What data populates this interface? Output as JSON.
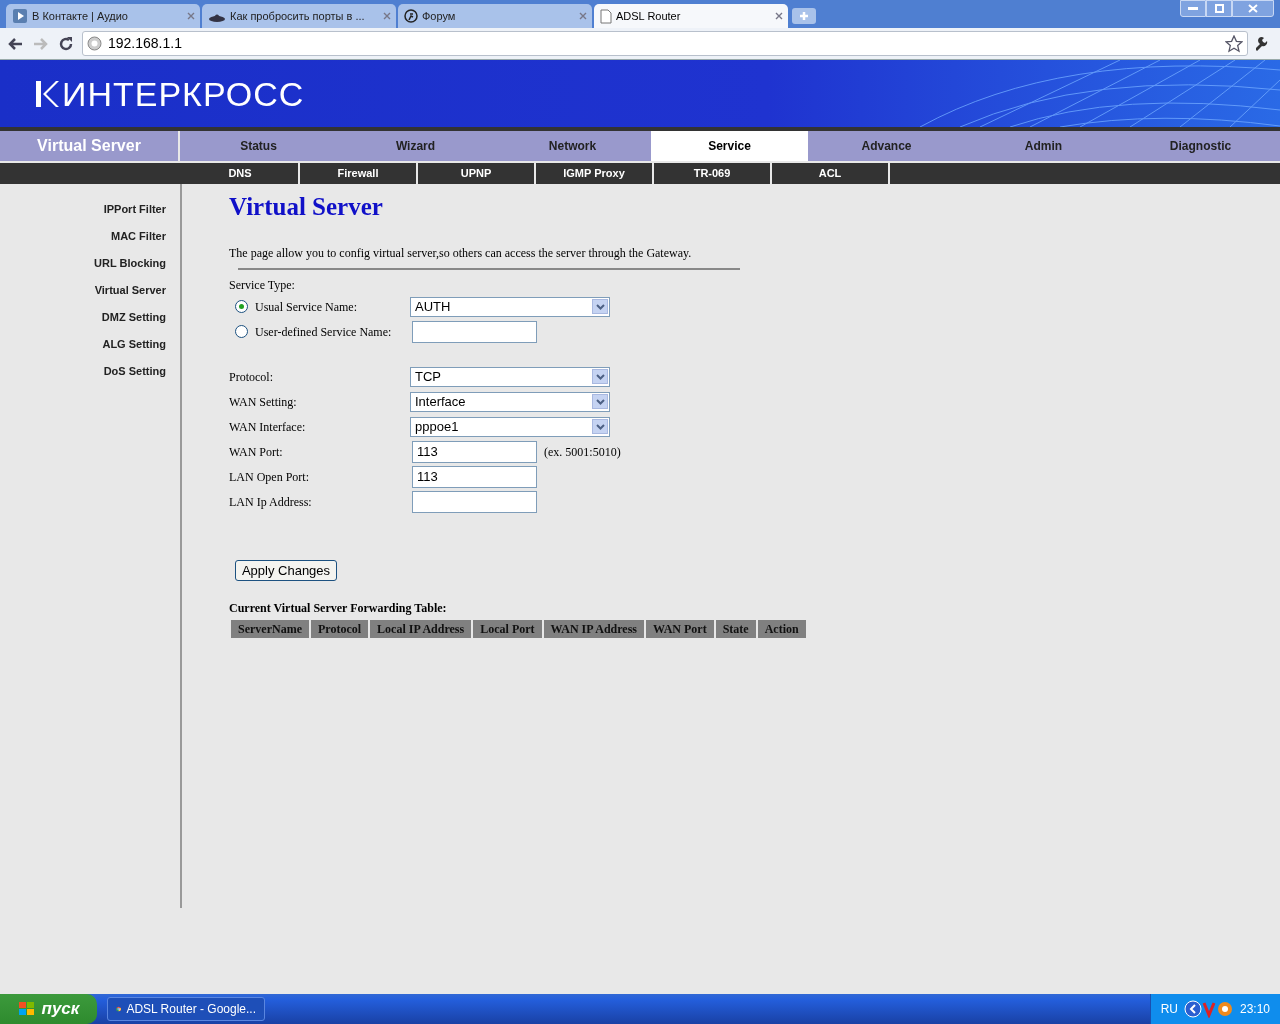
{
  "browser": {
    "tabs": [
      {
        "title": "В Контакте | Аудио",
        "selected": false,
        "kind": "play"
      },
      {
        "title": "Как пробросить порты в ...",
        "selected": false,
        "kind": "hat"
      },
      {
        "title": "Форум",
        "selected": false,
        "kind": "runner"
      },
      {
        "title": "ADSL Router",
        "selected": true,
        "kind": "page"
      }
    ],
    "address": "192.168.1.1"
  },
  "router": {
    "logo": "ИНТЕРКРОСС",
    "section_title": "Virtual Server",
    "nav": [
      {
        "label": "Status",
        "selected": false
      },
      {
        "label": "Wizard",
        "selected": false
      },
      {
        "label": "Network",
        "selected": false
      },
      {
        "label": "Service",
        "selected": true
      },
      {
        "label": "Advance",
        "selected": false
      },
      {
        "label": "Admin",
        "selected": false
      },
      {
        "label": "Diagnostic",
        "selected": false
      }
    ],
    "subnav": [
      "DNS",
      "Firewall",
      "UPNP",
      "IGMP Proxy",
      "TR-069",
      "ACL"
    ],
    "sidebar": [
      "IPPort Filter",
      "MAC Filter",
      "URL Blocking",
      "Virtual Server",
      "DMZ Setting",
      "ALG Setting",
      "DoS Setting"
    ],
    "heading": "Virtual Server",
    "description": "The page allow you to config virtual server,so others can access the server through the Gateway.",
    "service_type_label": "Service Type:",
    "service_options": [
      {
        "label": "Usual Service Name:",
        "selected": true,
        "kind": "select",
        "value": "AUTH"
      },
      {
        "label": "User-defined Service Name:",
        "selected": false,
        "kind": "text"
      }
    ],
    "fields": [
      {
        "label": "Protocol:",
        "kind": "select",
        "value": "TCP"
      },
      {
        "label": "WAN Setting:",
        "kind": "select",
        "value": "Interface"
      },
      {
        "label": "WAN Interface:",
        "kind": "select",
        "value": "pppoe1"
      },
      {
        "label": "WAN Port:",
        "kind": "text",
        "value": "113",
        "hint": "(ex. 5001:5010)"
      },
      {
        "label": "LAN Open Port:",
        "kind": "text",
        "value": "113"
      },
      {
        "label": "LAN Ip Address:",
        "kind": "text"
      }
    ],
    "apply_button": "Apply Changes",
    "table_title": "Current Virtual Server Forwarding Table:",
    "table_columns": [
      "ServerName",
      "Protocol",
      "Local IP Address",
      "Local Port",
      "WAN IP Address",
      "WAN Port",
      "State",
      "Action"
    ]
  },
  "taskbar": {
    "start": "пуск",
    "task": "ADSL Router - Google...",
    "language": "RU",
    "clock": "23:10"
  }
}
